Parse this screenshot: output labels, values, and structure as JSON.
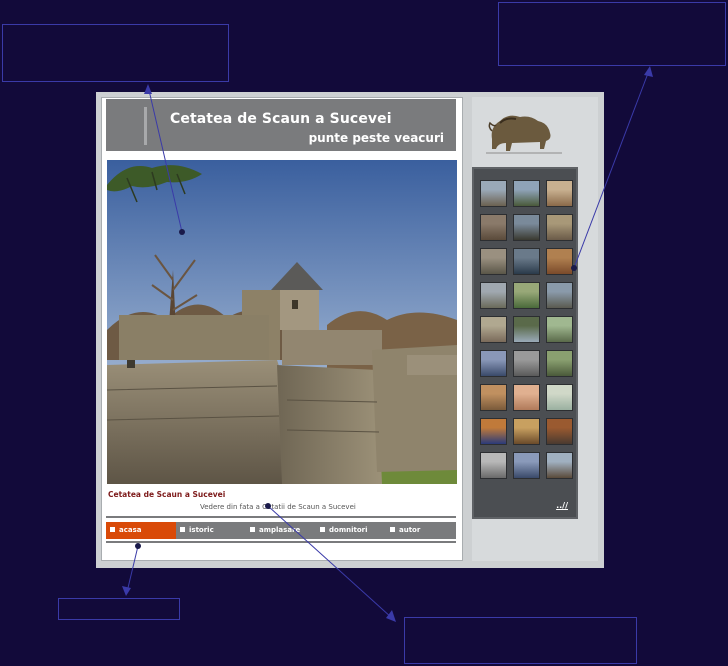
{
  "header": {
    "title": "Cetatea de Scaun a Sucevei",
    "subtitle": "punte peste veacuri"
  },
  "caption": {
    "title": "Cetatea de Scaun a Sucevei",
    "description": "Vedere din fata a Cetatii de Scaun a Sucevei"
  },
  "nav": {
    "items": [
      {
        "label": "acasa",
        "active": true
      },
      {
        "label": "istoric",
        "active": false
      },
      {
        "label": "amplasare",
        "active": false
      },
      {
        "label": "domnitori",
        "active": false
      },
      {
        "label": "autor",
        "active": false
      }
    ]
  },
  "gallery": {
    "more_label": "..//",
    "thumbnail_count": 27
  },
  "colors": {
    "background": "#120a3a",
    "header_gray": "#7a7b7d",
    "nav_active": "#d94a08",
    "caption_title": "#7d1a1a",
    "callout_line": "#3a3aa8"
  }
}
